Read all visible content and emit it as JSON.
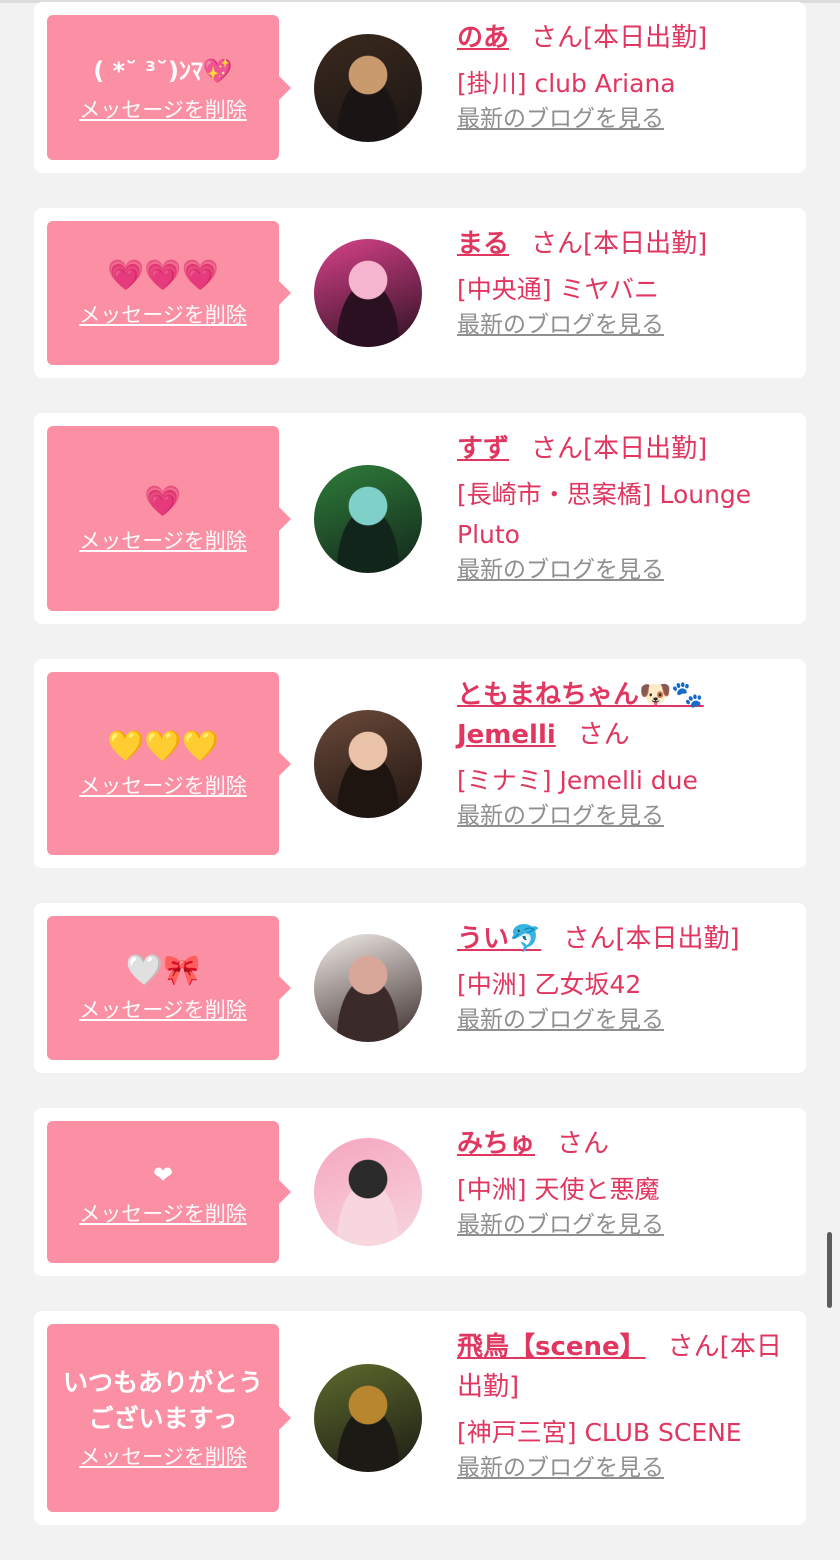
{
  "delete_label": "メッセージを削除",
  "blog_label": "最新のブログを見る",
  "items": [
    {
      "message": "( *˘ ³˘)ﾝﾏ💖",
      "name": "のあ",
      "san": "さん[本日出勤]",
      "shop": "[掛川] club Ariana",
      "avatar_colors": [
        "#3a2a1e",
        "#c99a6e",
        "#1b1414"
      ]
    },
    {
      "message": "💗💗💗",
      "name": "まる",
      "san": "さん[本日出勤]",
      "shop": "[中央通] ミヤバニ",
      "avatar_colors": [
        "#d9428a",
        "#f5b5cf",
        "#2a1020"
      ]
    },
    {
      "message": "💗",
      "name": "すず",
      "san": "さん[本日出勤]",
      "shop": "[長崎市・思案橋] Lounge Pluto",
      "avatar_colors": [
        "#2f7d3a",
        "#7fd0c9",
        "#12251a"
      ]
    },
    {
      "message": "💛💛💛",
      "name": "ともまねちゃん🐶🐾 Jemelli",
      "san": "さん",
      "shop": "[ミナミ] Jemelli due",
      "avatar_colors": [
        "#6b4a3a",
        "#e9c2a8",
        "#1e1410"
      ]
    },
    {
      "message": "🤍🎀",
      "name": "うい🐬",
      "san": "さん[本日出勤]",
      "shop": "[中洲] 乙女坂42",
      "avatar_colors": [
        "#f1ece9",
        "#d9a79a",
        "#3a2b2a"
      ]
    },
    {
      "message": "❤",
      "name": "みちゅ",
      "san": "さん",
      "shop": "[中洲] 天使と悪魔",
      "avatar_colors": [
        "#f5a6bf",
        "#2a2a2a",
        "#f7d6de"
      ]
    },
    {
      "message": "いつもありがとう\nございますっ",
      "name": "飛鳥【scene】",
      "san": "さん[本日出勤]",
      "shop": "[神戸三宮] CLUB SCENE",
      "avatar_colors": [
        "#5d6b2d",
        "#b8862f",
        "#1c1a14"
      ]
    }
  ]
}
